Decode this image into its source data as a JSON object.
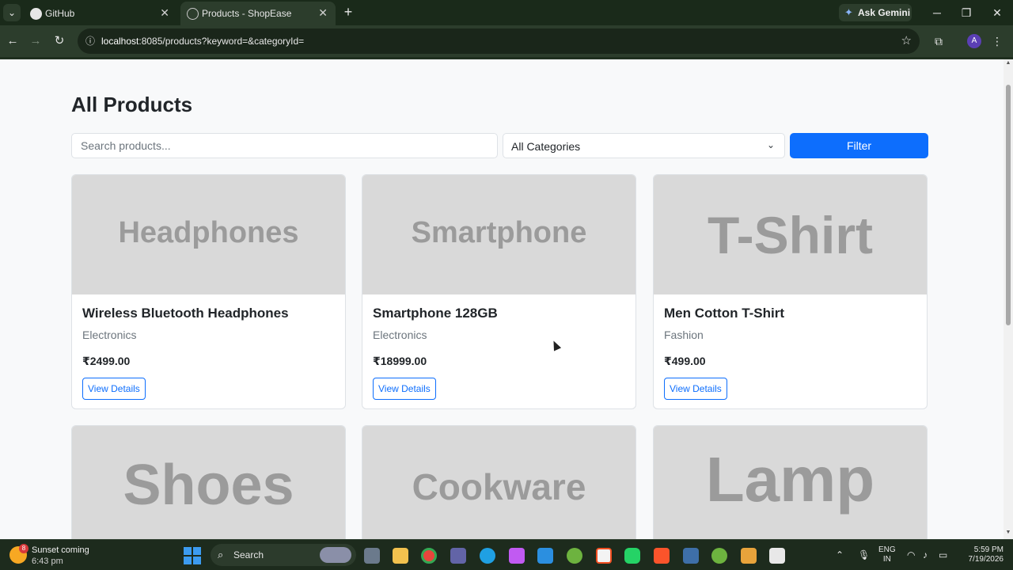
{
  "browser": {
    "tabs": [
      {
        "label": "GitHub",
        "active": false
      },
      {
        "label": "Products - ShopEase",
        "active": true
      }
    ],
    "gemini_label": "Ask Gemini",
    "url_host": "localhost",
    "url_rest": ":8085/products?keyword=&categoryId=",
    "profile_initial": "A"
  },
  "page": {
    "title": "All Products",
    "search_placeholder": "Search products...",
    "category_selected": "All Categories",
    "filter_label": "Filter"
  },
  "products": [
    {
      "image_text": "Headphones",
      "name": "Wireless Bluetooth Headphones",
      "category": "Electronics",
      "price": "₹2499.00",
      "button": "View Details"
    },
    {
      "image_text": "Smartphone",
      "name": "Smartphone 128GB",
      "category": "Electronics",
      "price": "₹18999.00",
      "button": "View Details"
    },
    {
      "image_text": "T-Shirt",
      "name": "Men Cotton T-Shirt",
      "category": "Fashion",
      "price": "₹499.00",
      "button": "View Details"
    },
    {
      "image_text": "Shoes"
    },
    {
      "image_text": "Cookware"
    },
    {
      "image_text": "Lamp"
    }
  ],
  "taskbar": {
    "weather_title": "Sunset coming",
    "weather_time": "6:43 pm",
    "weather_badge": "8",
    "search_label": "Search",
    "lang_line1": "ENG",
    "lang_line2": "IN",
    "time": "5:59 PM",
    "date": "7/19/2026"
  }
}
